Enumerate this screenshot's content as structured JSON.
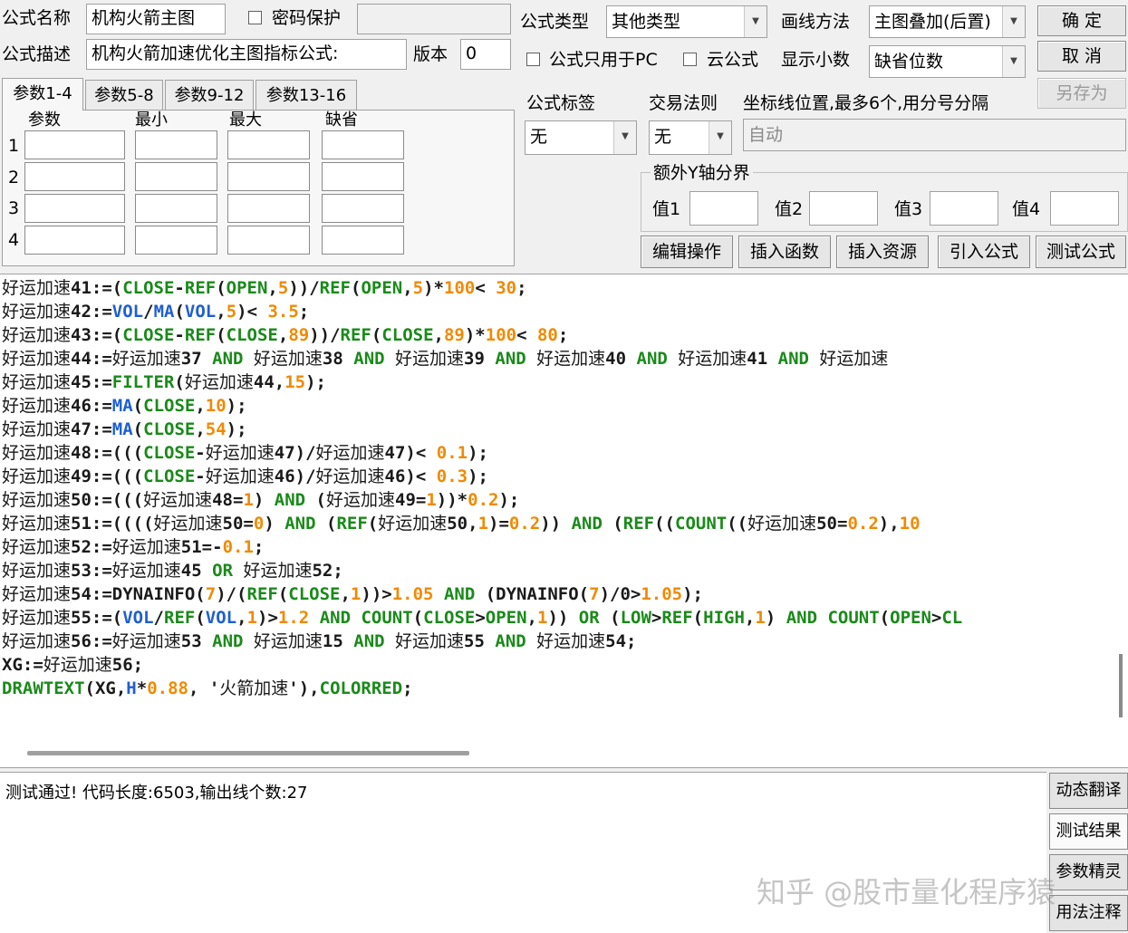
{
  "header": {
    "name_label": "公式名称",
    "name_value": "机构火箭主图",
    "password_label": "密码保护",
    "password_value": "",
    "desc_label": "公式描述",
    "desc_value": "机构火箭加速优化主图指标公式:",
    "version_label": "版本",
    "version_value": "0"
  },
  "formula": {
    "type_label": "公式类型",
    "type_value": "其他类型",
    "draw_label": "画线方法",
    "draw_value": "主图叠加(后置)",
    "pc_only_label": "公式只用于PC",
    "cloud_label": "云公式",
    "decimals_label": "显示小数",
    "decimals_value": "缺省位数",
    "tag_label": "公式标签",
    "tag_value": "无",
    "rule_label": "交易法则",
    "rule_value": "无",
    "axis_label": "坐标线位置,最多6个,用分号分隔",
    "axis_placeholder": "自动",
    "yaxis_title": "额外Y轴分界",
    "y_values": [
      "值1",
      "值2",
      "值3",
      "值4"
    ]
  },
  "buttons": {
    "ok": "确 定",
    "cancel": "取 消",
    "saveas": "另存为",
    "edit": "编辑操作",
    "insert_func": "插入函数",
    "insert_res": "插入资源",
    "import": "引入公式",
    "test": "测试公式"
  },
  "params": {
    "tabs": [
      "参数1-4",
      "参数5-8",
      "参数9-12",
      "参数13-16"
    ],
    "columns": [
      "参数",
      "最小",
      "最大",
      "缺省"
    ],
    "rows": [
      "1",
      "2",
      "3",
      "4"
    ]
  },
  "code": {
    "colors": {
      "default": "#1a1a1a",
      "function": "#1a8a1a",
      "operator": "#1a8a1a",
      "builtin": "#1f5fd0",
      "number": "#f08a00"
    },
    "lines": [
      [
        [
          "d",
          "好运加速"
        ],
        [
          "d",
          "41:=("
        ],
        [
          "f",
          "CLOSE"
        ],
        [
          "d",
          "-"
        ],
        [
          "f",
          "REF"
        ],
        [
          "d",
          "("
        ],
        [
          "f",
          "OPEN"
        ],
        [
          "d",
          ","
        ],
        [
          "n",
          "5"
        ],
        [
          "d",
          "))/"
        ],
        [
          "f",
          "REF"
        ],
        [
          "d",
          "("
        ],
        [
          "f",
          "OPEN"
        ],
        [
          "d",
          ","
        ],
        [
          "n",
          "5"
        ],
        [
          "d",
          ")*"
        ],
        [
          "n",
          "100"
        ],
        [
          "d",
          "< "
        ],
        [
          "n",
          "30"
        ],
        [
          "d",
          ";"
        ]
      ],
      [
        [
          "d",
          "好运加速"
        ],
        [
          "d",
          "42:="
        ],
        [
          "b",
          "VOL"
        ],
        [
          "d",
          "/"
        ],
        [
          "b",
          "MA"
        ],
        [
          "d",
          "("
        ],
        [
          "b",
          "VOL"
        ],
        [
          "d",
          ","
        ],
        [
          "n",
          "5"
        ],
        [
          "d",
          ")< "
        ],
        [
          "n",
          "3.5"
        ],
        [
          "d",
          ";"
        ]
      ],
      [
        [
          "d",
          "好运加速"
        ],
        [
          "d",
          "43:=("
        ],
        [
          "f",
          "CLOSE"
        ],
        [
          "d",
          "-"
        ],
        [
          "f",
          "REF"
        ],
        [
          "d",
          "("
        ],
        [
          "f",
          "CLOSE"
        ],
        [
          "d",
          ","
        ],
        [
          "n",
          "89"
        ],
        [
          "d",
          "))/"
        ],
        [
          "f",
          "REF"
        ],
        [
          "d",
          "("
        ],
        [
          "f",
          "CLOSE"
        ],
        [
          "d",
          ","
        ],
        [
          "n",
          "89"
        ],
        [
          "d",
          ")*"
        ],
        [
          "n",
          "100"
        ],
        [
          "d",
          "< "
        ],
        [
          "n",
          "80"
        ],
        [
          "d",
          ";"
        ]
      ],
      [
        [
          "d",
          "好运加速"
        ],
        [
          "d",
          "44:="
        ],
        [
          "d",
          "好运加速"
        ],
        [
          "d",
          "37 "
        ],
        [
          "o",
          "AND"
        ],
        [
          "d",
          " "
        ],
        [
          "d",
          "好运加速"
        ],
        [
          "d",
          "38 "
        ],
        [
          "o",
          "AND"
        ],
        [
          "d",
          " "
        ],
        [
          "d",
          "好运加速"
        ],
        [
          "d",
          "39 "
        ],
        [
          "o",
          "AND"
        ],
        [
          "d",
          " "
        ],
        [
          "d",
          "好运加速"
        ],
        [
          "d",
          "40 "
        ],
        [
          "o",
          "AND"
        ],
        [
          "d",
          " "
        ],
        [
          "d",
          "好运加速"
        ],
        [
          "d",
          "41 "
        ],
        [
          "o",
          "AND"
        ],
        [
          "d",
          " "
        ],
        [
          "d",
          "好运加速"
        ]
      ],
      [
        [
          "d",
          "好运加速"
        ],
        [
          "d",
          "45:="
        ],
        [
          "f",
          "FILTER"
        ],
        [
          "d",
          "("
        ],
        [
          "d",
          "好运加速"
        ],
        [
          "d",
          "44,"
        ],
        [
          "n",
          "15"
        ],
        [
          "d",
          ");"
        ]
      ],
      [
        [
          "d",
          "好运加速"
        ],
        [
          "d",
          "46:="
        ],
        [
          "b",
          "MA"
        ],
        [
          "d",
          "("
        ],
        [
          "f",
          "CLOSE"
        ],
        [
          "d",
          ","
        ],
        [
          "n",
          "10"
        ],
        [
          "d",
          ");"
        ]
      ],
      [
        [
          "d",
          "好运加速"
        ],
        [
          "d",
          "47:="
        ],
        [
          "b",
          "MA"
        ],
        [
          "d",
          "("
        ],
        [
          "f",
          "CLOSE"
        ],
        [
          "d",
          ","
        ],
        [
          "n",
          "54"
        ],
        [
          "d",
          ");"
        ]
      ],
      [
        [
          "d",
          "好运加速"
        ],
        [
          "d",
          "48:=((("
        ],
        [
          "f",
          "CLOSE"
        ],
        [
          "d",
          "-"
        ],
        [
          "d",
          "好运加速"
        ],
        [
          "d",
          "47)/"
        ],
        [
          "d",
          "好运加速"
        ],
        [
          "d",
          "47)< "
        ],
        [
          "n",
          "0.1"
        ],
        [
          "d",
          ");"
        ]
      ],
      [
        [
          "d",
          "好运加速"
        ],
        [
          "d",
          "49:=((("
        ],
        [
          "f",
          "CLOSE"
        ],
        [
          "d",
          "-"
        ],
        [
          "d",
          "好运加速"
        ],
        [
          "d",
          "46)/"
        ],
        [
          "d",
          "好运加速"
        ],
        [
          "d",
          "46)< "
        ],
        [
          "n",
          "0.3"
        ],
        [
          "d",
          ");"
        ]
      ],
      [
        [
          "d",
          "好运加速"
        ],
        [
          "d",
          "50:=((("
        ],
        [
          "d",
          "好运加速"
        ],
        [
          "d",
          "48="
        ],
        [
          "n",
          "1"
        ],
        [
          "d",
          ") "
        ],
        [
          "o",
          "AND"
        ],
        [
          "d",
          " ("
        ],
        [
          "d",
          "好运加速"
        ],
        [
          "d",
          "49="
        ],
        [
          "n",
          "1"
        ],
        [
          "d",
          "))*"
        ],
        [
          "n",
          "0.2"
        ],
        [
          "d",
          ");"
        ]
      ],
      [
        [
          "d",
          "好运加速"
        ],
        [
          "d",
          "51:=(((("
        ],
        [
          "d",
          "好运加速"
        ],
        [
          "d",
          "50="
        ],
        [
          "n",
          "0"
        ],
        [
          "d",
          ") "
        ],
        [
          "o",
          "AND"
        ],
        [
          "d",
          " ("
        ],
        [
          "f",
          "REF"
        ],
        [
          "d",
          "("
        ],
        [
          "d",
          "好运加速"
        ],
        [
          "d",
          "50,"
        ],
        [
          "n",
          "1"
        ],
        [
          "d",
          ")="
        ],
        [
          "n",
          "0.2"
        ],
        [
          "d",
          ")) "
        ],
        [
          "o",
          "AND"
        ],
        [
          "d",
          " ("
        ],
        [
          "f",
          "REF"
        ],
        [
          "d",
          "(("
        ],
        [
          "f",
          "COUNT"
        ],
        [
          "d",
          "(("
        ],
        [
          "d",
          "好运加速"
        ],
        [
          "d",
          "50="
        ],
        [
          "n",
          "0.2"
        ],
        [
          "d",
          "),"
        ],
        [
          "n",
          "10"
        ]
      ],
      [
        [
          "d",
          "好运加速"
        ],
        [
          "d",
          "52:="
        ],
        [
          "d",
          "好运加速"
        ],
        [
          "d",
          "51=-"
        ],
        [
          "n",
          "0.1"
        ],
        [
          "d",
          ";"
        ]
      ],
      [
        [
          "d",
          "好运加速"
        ],
        [
          "d",
          "53:="
        ],
        [
          "d",
          "好运加速"
        ],
        [
          "d",
          "45 "
        ],
        [
          "o",
          "OR"
        ],
        [
          "d",
          " "
        ],
        [
          "d",
          "好运加速"
        ],
        [
          "d",
          "52;"
        ]
      ],
      [
        [
          "d",
          "好运加速"
        ],
        [
          "d",
          "54:=DYNAINFO("
        ],
        [
          "n",
          "7"
        ],
        [
          "d",
          ")/("
        ],
        [
          "f",
          "REF"
        ],
        [
          "d",
          "("
        ],
        [
          "f",
          "CLOSE"
        ],
        [
          "d",
          ","
        ],
        [
          "n",
          "1"
        ],
        [
          "d",
          "))>"
        ],
        [
          "n",
          "1.05"
        ],
        [
          "d",
          " "
        ],
        [
          "o",
          "AND"
        ],
        [
          "d",
          " (DYNAINFO("
        ],
        [
          "n",
          "7"
        ],
        [
          "d",
          ")/0>"
        ],
        [
          "n",
          "1.05"
        ],
        [
          "d",
          ");"
        ]
      ],
      [
        [
          "d",
          "好运加速"
        ],
        [
          "d",
          "55:=("
        ],
        [
          "b",
          "VOL"
        ],
        [
          "d",
          "/"
        ],
        [
          "f",
          "REF"
        ],
        [
          "d",
          "("
        ],
        [
          "b",
          "VOL"
        ],
        [
          "d",
          ","
        ],
        [
          "n",
          "1"
        ],
        [
          "d",
          ")>"
        ],
        [
          "n",
          "1.2"
        ],
        [
          "d",
          " "
        ],
        [
          "o",
          "AND"
        ],
        [
          "d",
          " "
        ],
        [
          "f",
          "COUNT"
        ],
        [
          "d",
          "("
        ],
        [
          "f",
          "CLOSE"
        ],
        [
          "d",
          ">"
        ],
        [
          "f",
          "OPEN"
        ],
        [
          "d",
          ","
        ],
        [
          "n",
          "1"
        ],
        [
          "d",
          ")) "
        ],
        [
          "o",
          "OR"
        ],
        [
          "d",
          " ("
        ],
        [
          "f",
          "LOW"
        ],
        [
          "d",
          ">"
        ],
        [
          "f",
          "REF"
        ],
        [
          "d",
          "("
        ],
        [
          "f",
          "HIGH"
        ],
        [
          "d",
          ","
        ],
        [
          "n",
          "1"
        ],
        [
          "d",
          ") "
        ],
        [
          "o",
          "AND"
        ],
        [
          "d",
          " "
        ],
        [
          "f",
          "COUNT"
        ],
        [
          "d",
          "("
        ],
        [
          "f",
          "OPEN"
        ],
        [
          "d",
          ">"
        ],
        [
          "f",
          "CL"
        ]
      ],
      [
        [
          "d",
          "好运加速"
        ],
        [
          "d",
          "56:="
        ],
        [
          "d",
          "好运加速"
        ],
        [
          "d",
          "53 "
        ],
        [
          "o",
          "AND"
        ],
        [
          "d",
          " "
        ],
        [
          "d",
          "好运加速"
        ],
        [
          "d",
          "15 "
        ],
        [
          "o",
          "AND"
        ],
        [
          "d",
          " "
        ],
        [
          "d",
          "好运加速"
        ],
        [
          "d",
          "55 "
        ],
        [
          "o",
          "AND"
        ],
        [
          "d",
          " "
        ],
        [
          "d",
          "好运加速"
        ],
        [
          "d",
          "54;"
        ]
      ],
      [
        [
          "d",
          "XG:="
        ],
        [
          "d",
          "好运加速"
        ],
        [
          "d",
          "56;"
        ]
      ],
      [
        [
          "f",
          "DRAWTEXT"
        ],
        [
          "d",
          "(XG,"
        ],
        [
          "b",
          "H"
        ],
        [
          "d",
          "*"
        ],
        [
          "n",
          "0.88"
        ],
        [
          "d",
          ", '"
        ],
        [
          "d",
          "火箭加速"
        ],
        [
          "d",
          "'),"
        ],
        [
          "f",
          "COLORRED"
        ],
        [
          "d",
          ";"
        ]
      ]
    ]
  },
  "result": {
    "text": "测试通过! 代码长度:6503,输出线个数:27"
  },
  "side_buttons": [
    "动态翻译",
    "测试结果",
    "参数精灵",
    "用法注释"
  ],
  "watermark": "知乎 @股市量化程序猿"
}
